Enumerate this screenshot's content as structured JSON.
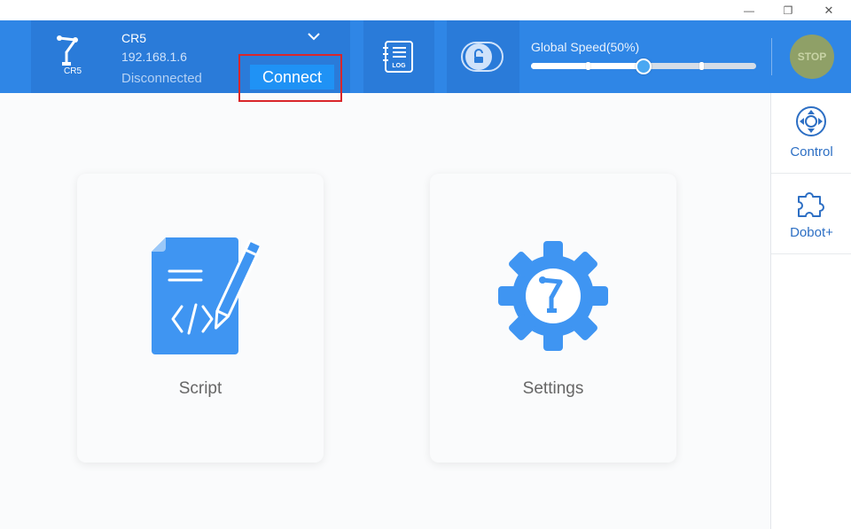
{
  "window": {
    "minimize_glyph": "—",
    "restore_glyph": "❐",
    "close_glyph": "✕"
  },
  "robot": {
    "short_label": "CR5",
    "name": "CR5",
    "ip": "192.168.1.6",
    "status": "Disconnected",
    "connect_label": "Connect"
  },
  "toolbar": {
    "log_icon_text": "LOG",
    "speed_label": "Global Speed(50%)",
    "speed_value": 50,
    "stop_label": "STOP"
  },
  "sidebar": {
    "items": [
      {
        "label": "Control",
        "icon": "directional-pad-icon"
      },
      {
        "label": "Dobot+",
        "icon": "puzzle-piece-icon"
      }
    ]
  },
  "main": {
    "cards": [
      {
        "label": "Script",
        "icon": "script-document-icon"
      },
      {
        "label": "Settings",
        "icon": "settings-gear-icon"
      }
    ]
  },
  "colors": {
    "header": "#2f86e6",
    "header_tile": "#2a7bd9",
    "connect_button": "#1f92f5",
    "stop_button": "#8fa067",
    "accent_blue": "#4aa8f2",
    "highlight": "#d9262a"
  }
}
